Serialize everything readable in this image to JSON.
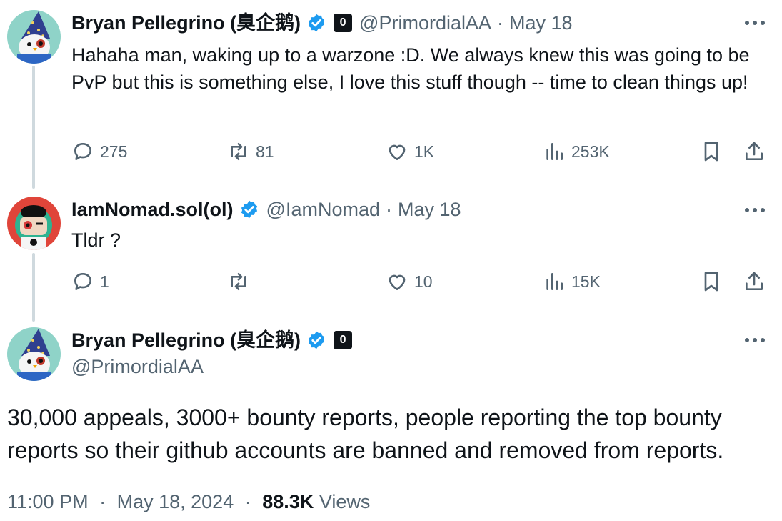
{
  "tweets": [
    {
      "name": "Bryan Pellegrino (臭企鹅)",
      "handle": "@PrimordialAA",
      "separator": "·",
      "date": "May 18",
      "text": "Hahaha man, waking up to a warzone :D. We always knew this was going to be PvP but this is something else, I love this stuff though -- time to clean things up!",
      "stats": {
        "replies": "275",
        "retweets": "81",
        "likes": "1K",
        "views": "253K"
      }
    },
    {
      "name": "IamNomad.sol(ol)",
      "handle": "@IamNomad",
      "separator": "·",
      "date": "May 18",
      "text": "Tldr ?",
      "stats": {
        "replies": "1",
        "retweets": "",
        "likes": "10",
        "views": "15K"
      }
    }
  ],
  "main_tweet": {
    "name": "Bryan Pellegrino (臭企鹅)",
    "handle": "@PrimordialAA",
    "text": "30,000 appeals, 3000+ bounty reports, people reporting the top bounty reports so their github accounts are banned and removed from reports.",
    "time": "11:00 PM",
    "separator": "·",
    "date": "May 18, 2024",
    "views_count": "88.3K",
    "views_label": "Views"
  },
  "affiliate_badge_text": "0",
  "icons": {
    "verified": "verified-badge-icon",
    "affiliate": "layerzero-badge-icon",
    "more": "more-icon",
    "reply": "reply-icon",
    "retweet": "retweet-icon",
    "like": "like-icon",
    "views": "views-icon",
    "bookmark": "bookmark-icon",
    "share": "share-icon"
  },
  "colors": {
    "text": "#0f1419",
    "secondary": "#536471",
    "verified": "#1d9bf0",
    "thread_line": "#cfd9de"
  }
}
